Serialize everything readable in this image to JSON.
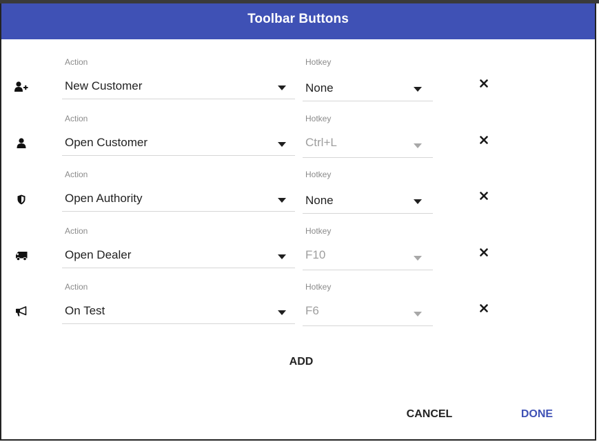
{
  "dialog": {
    "title": "Toolbar Buttons",
    "accent_color": "#3f51b5"
  },
  "rows": [
    {
      "icon": "user-plus-icon",
      "action_label": "Action",
      "action_value": "New Customer",
      "hotkey_label": "Hotkey",
      "hotkey_value": "None",
      "hotkey_disabled": false
    },
    {
      "icon": "user-icon",
      "action_label": "Action",
      "action_value": "Open Customer",
      "hotkey_label": "Hotkey",
      "hotkey_value": "Ctrl+L",
      "hotkey_disabled": true
    },
    {
      "icon": "shield-icon",
      "action_label": "Action",
      "action_value": "Open Authority",
      "hotkey_label": "Hotkey",
      "hotkey_value": "None",
      "hotkey_disabled": false
    },
    {
      "icon": "truck-icon",
      "action_label": "Action",
      "action_value": "Open Dealer",
      "hotkey_label": "Hotkey",
      "hotkey_value": "F10",
      "hotkey_disabled": true
    },
    {
      "icon": "megaphone-icon",
      "action_label": "Action",
      "action_value": "On Test",
      "hotkey_label": "Hotkey",
      "hotkey_value": "F6",
      "hotkey_disabled": true
    }
  ],
  "buttons": {
    "add": "ADD",
    "cancel": "CANCEL",
    "done": "DONE"
  }
}
